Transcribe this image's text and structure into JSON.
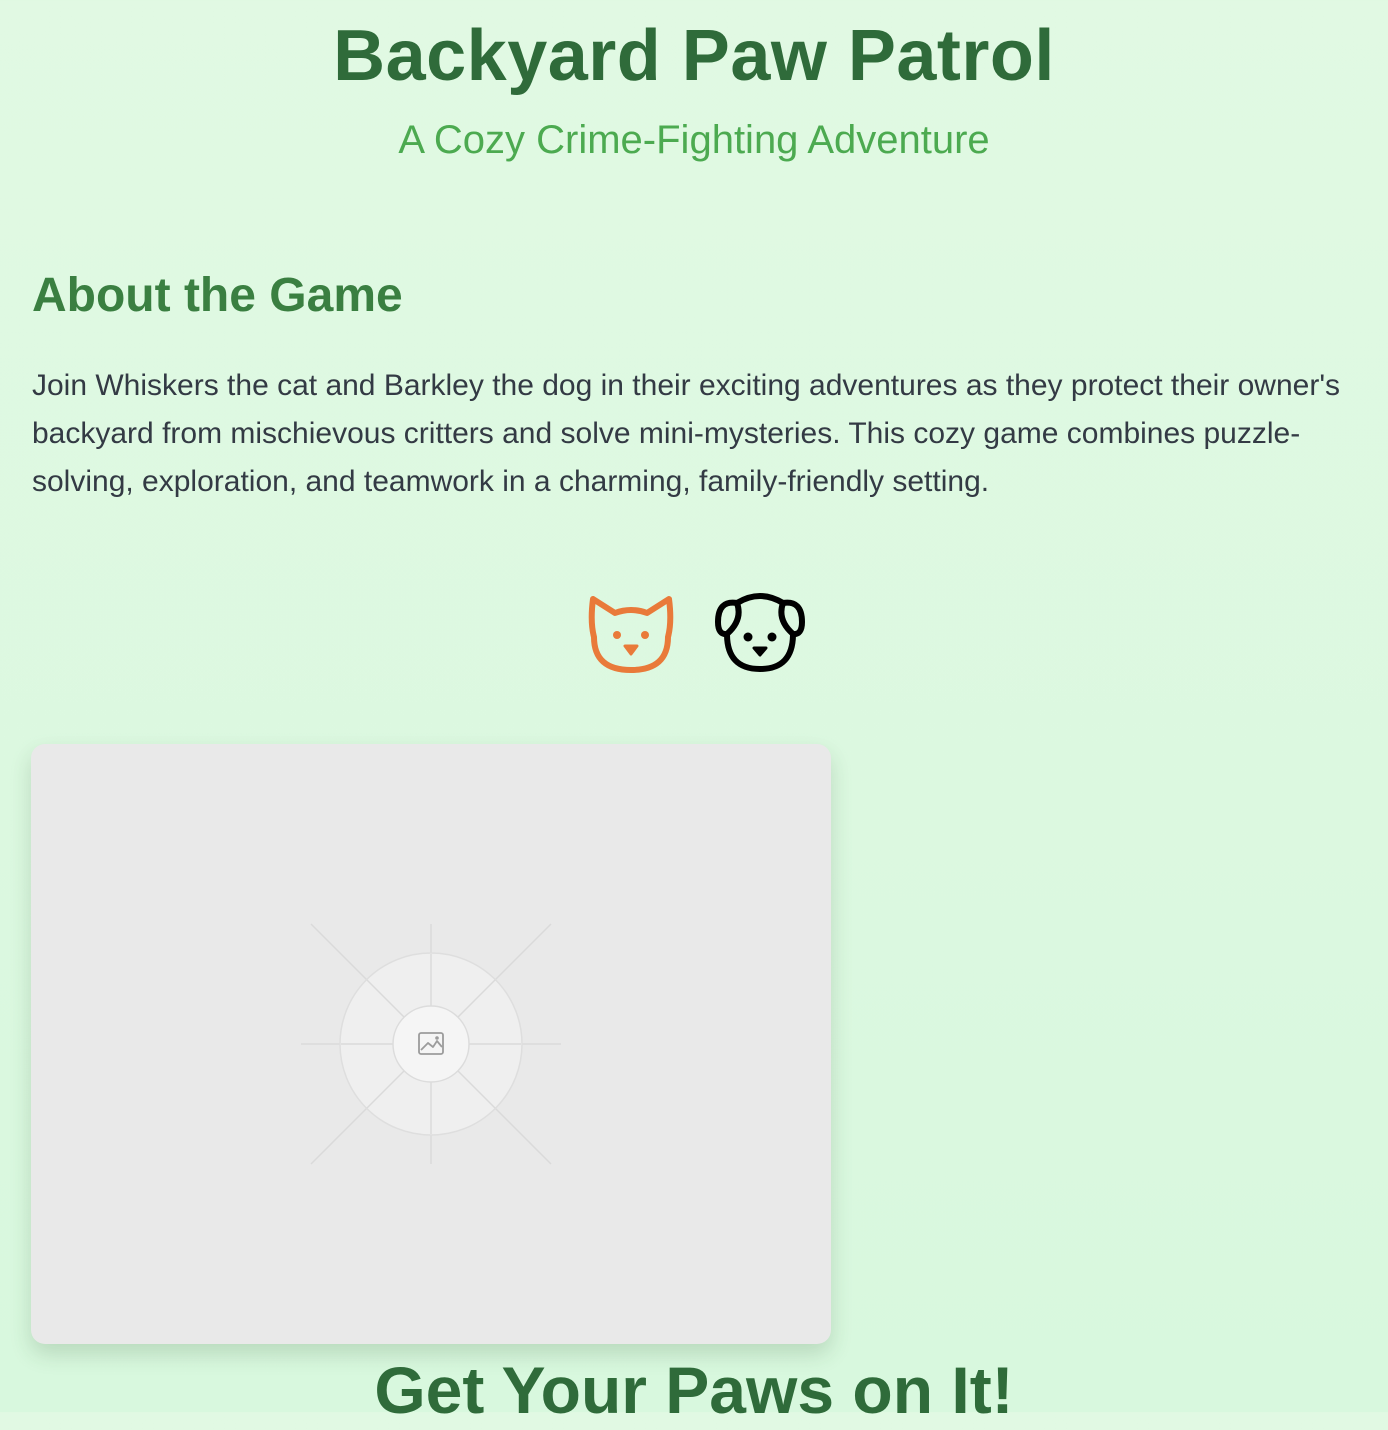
{
  "header": {
    "title": "Backyard Paw Patrol",
    "subtitle": "A Cozy Crime-Fighting Adventure"
  },
  "about": {
    "heading": "About the Game",
    "text": "Join Whiskers the cat and Barkley the dog in their exciting adventures as they protect their owner's backyard from mischievous critters and solve mini-mysteries. This cozy game combines puzzle-solving, exploration, and teamwork in a charming, family-friendly setting."
  },
  "characters": {
    "icons": [
      "cat-icon",
      "dog-icon"
    ],
    "colors": {
      "cat": "#e97a3a",
      "dog": "#000000"
    }
  },
  "screenshot": {
    "icon": "image-placeholder-icon",
    "background": "#e9e9e9"
  },
  "cta": {
    "heading": "Get Your Paws on It!"
  },
  "theme": {
    "background": "#e1f9e3",
    "title_color": "#2f6b3a",
    "subtitle_color": "#4caa50",
    "heading_color": "#3a7f41",
    "text_color": "#333a44"
  }
}
